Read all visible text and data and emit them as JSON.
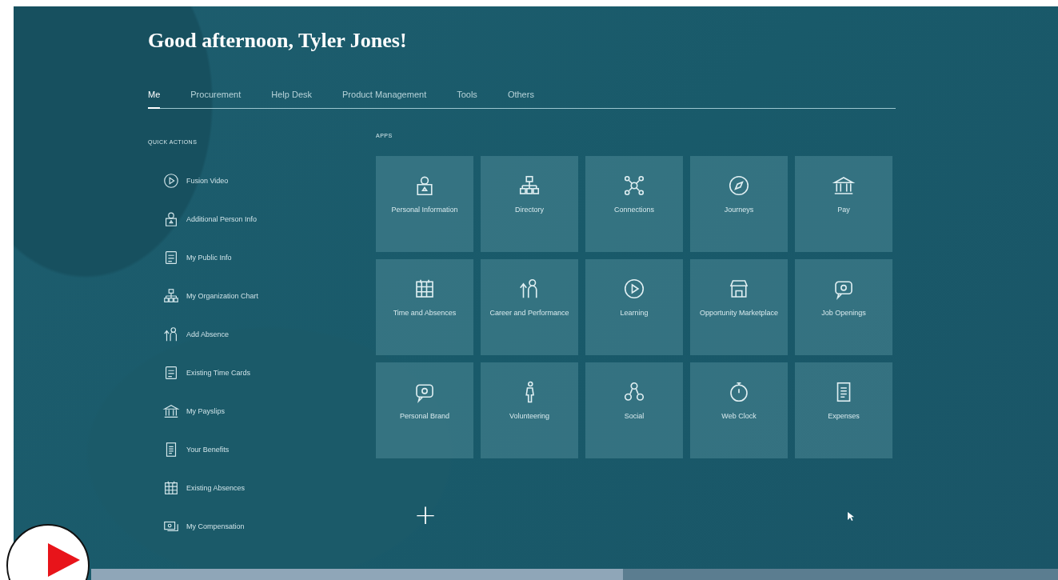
{
  "greeting": "Good afternoon, Tyler Jones!",
  "tabs": [
    {
      "label": "Me",
      "selected": true
    },
    {
      "label": "Procurement",
      "selected": false
    },
    {
      "label": "Help Desk",
      "selected": false
    },
    {
      "label": "Product Management",
      "selected": false
    },
    {
      "label": "Tools",
      "selected": false
    },
    {
      "label": "Others",
      "selected": false
    }
  ],
  "quick_actions": {
    "title": "QUICK ACTIONS",
    "items": [
      "Fusion Video",
      "Additional Person Info",
      "My Public Info",
      "My Organization Chart",
      "Add Absence",
      "Existing Time Cards",
      "My Payslips",
      "Your Benefits",
      "Existing Absences",
      "My Compensation"
    ]
  },
  "apps": {
    "title": "APPS",
    "items": [
      "Personal Information",
      "Directory",
      "Connections",
      "Journeys",
      "Pay",
      "Time and Absences",
      "Career and Performance",
      "Learning",
      "Opportunity Marketplace",
      "Job Openings",
      "Personal Brand",
      "Volunteering",
      "Social",
      "Web Clock",
      "Expenses"
    ],
    "add_button": "+"
  },
  "video_player": {
    "level": 0.55
  }
}
